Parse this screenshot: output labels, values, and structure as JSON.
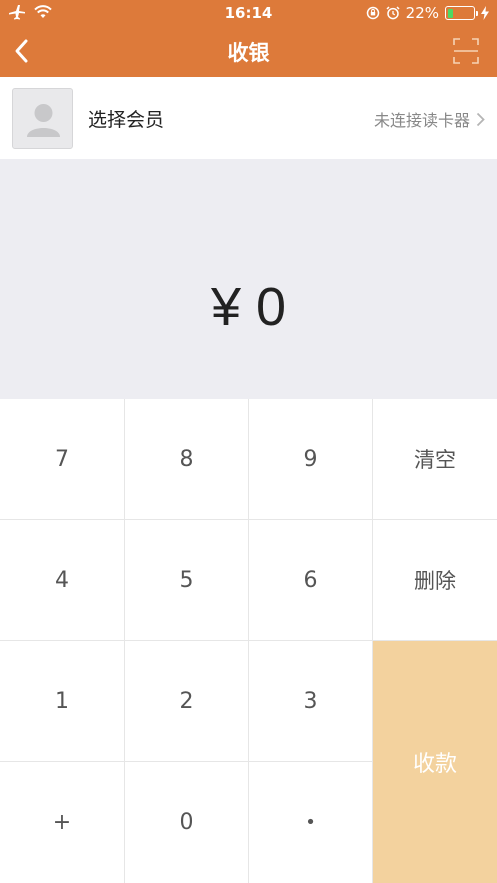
{
  "status_bar": {
    "time": "16:14",
    "battery": "22%",
    "battery_level": 0.22
  },
  "nav": {
    "title": "收银"
  },
  "member": {
    "label": "选择会员",
    "reader_status": "未连接读卡器"
  },
  "amount": {
    "display": "¥ 0"
  },
  "keypad": {
    "k7": "7",
    "k8": "8",
    "k9": "9",
    "clear": "清空",
    "k4": "4",
    "k5": "5",
    "k6": "6",
    "delete": "删除",
    "k1": "1",
    "k2": "2",
    "k3": "3",
    "collect": "收款",
    "plus": "+",
    "k0": "0",
    "dot": "•"
  },
  "colors": {
    "accent": "#DD7A3A",
    "collect_button": "#F3D29E",
    "amount_background": "#EDEDF2"
  }
}
